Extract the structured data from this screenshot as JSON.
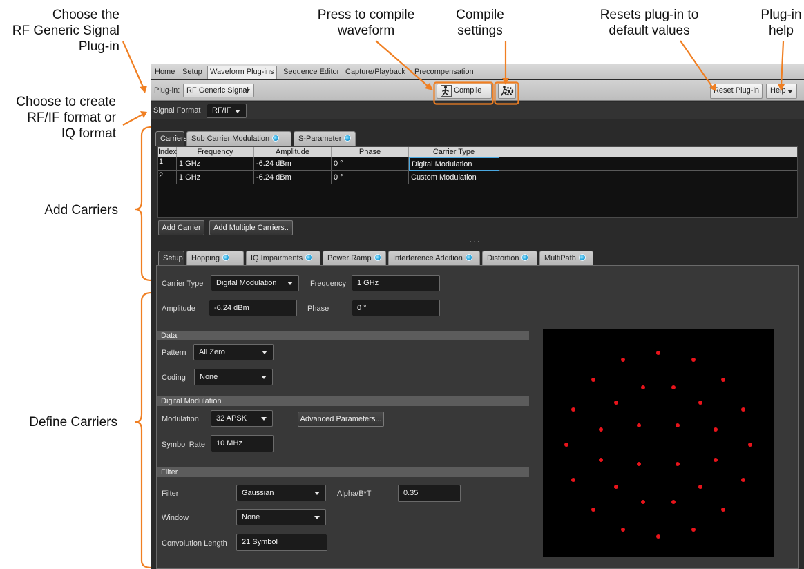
{
  "callouts": {
    "choose_plugin": [
      "Choose the",
      "RF Generic Signal",
      "Plug-in"
    ],
    "choose_format": [
      "Choose to create",
      "RF/IF format or",
      "IQ format"
    ],
    "add_carriers": "Add Carriers",
    "define_carriers": "Define Carriers",
    "compile_waveform": [
      "Press to compile",
      "waveform"
    ],
    "compile_settings": [
      "Compile",
      "settings"
    ],
    "reset": [
      "Resets plug-in to",
      "default values"
    ],
    "help": [
      "Plug-in",
      "help"
    ]
  },
  "colors": {
    "callout_accent": "#f07f22",
    "constellation_point": "#e8141b",
    "status_dot": "#1fa2dc"
  },
  "menu": {
    "tabs": [
      "Home",
      "Setup",
      "Waveform Plug-ins",
      "Sequence Editor",
      "Capture/Playback",
      "Precompensation"
    ],
    "active": "Waveform Plug-ins"
  },
  "toolbar": {
    "plugin_label": "Plug-in:",
    "plugin_value": "RF Generic Signal",
    "compile_label": "Compile",
    "compile_icon": "compile-runner-icon",
    "settings_icon": "gear-runner-icon",
    "reset_label": "Reset Plug-in",
    "help_label": "Help"
  },
  "signal_format": {
    "label": "Signal Format",
    "value": "RF/IF"
  },
  "top_tabs": [
    {
      "label": "Carriers",
      "active": true,
      "dot": false
    },
    {
      "label": "Sub Carrier Modulation",
      "active": false,
      "dot": true
    },
    {
      "label": "S-Parameter",
      "active": false,
      "dot": true
    }
  ],
  "carriers_table": {
    "headers": [
      "Index",
      "Frequency",
      "Amplitude",
      "Phase",
      "Carrier Type"
    ],
    "rows": [
      [
        "1",
        "1 GHz",
        "-6.24 dBm",
        "0 °",
        "Digital Modulation"
      ],
      [
        "2",
        "1 GHz",
        "-6.24 dBm",
        "0 °",
        "Custom Modulation"
      ]
    ]
  },
  "carrier_buttons": {
    "add": "Add Carrier",
    "add_multiple": "Add Multiple Carriers.."
  },
  "splitter": "· · ·",
  "sub_tabs": [
    {
      "label": "Setup",
      "active": true,
      "dot": false
    },
    {
      "label": "Hopping",
      "active": false,
      "dot": true
    },
    {
      "label": "IQ Impairments",
      "active": false,
      "dot": true
    },
    {
      "label": "Power Ramp",
      "active": false,
      "dot": true
    },
    {
      "label": "Interference Addition",
      "active": false,
      "dot": true
    },
    {
      "label": "Distortion",
      "active": false,
      "dot": true
    },
    {
      "label": "MultiPath",
      "active": false,
      "dot": true
    }
  ],
  "setup": {
    "carrier_type_label": "Carrier Type",
    "carrier_type_value": "Digital Modulation",
    "frequency_label": "Frequency",
    "frequency_value": "1 GHz",
    "amplitude_label": "Amplitude",
    "amplitude_value": "-6.24 dBm",
    "phase_label": "Phase",
    "phase_value": "0 °"
  },
  "data_section": {
    "title": "Data",
    "pattern_label": "Pattern",
    "pattern_value": "All Zero",
    "coding_label": "Coding",
    "coding_value": "None"
  },
  "modulation_section": {
    "title": "Digital Modulation",
    "modulation_label": "Modulation",
    "modulation_value": "32 APSK",
    "advanced_label": "Advanced Parameters...",
    "symbol_rate_label": "Symbol Rate",
    "symbol_rate_value": "10 MHz"
  },
  "filter_section": {
    "title": "Filter",
    "filter_label": "Filter",
    "filter_value": "Gaussian",
    "alpha_label": "Alpha/B*T",
    "alpha_value": "0.35",
    "window_label": "Window",
    "window_value": "None",
    "conv_label": "Convolution Length",
    "conv_value": "21 Symbol"
  },
  "constellation": {
    "modulation": "32 APSK",
    "rings": [
      {
        "radius": 1,
        "count": 4,
        "phase_deg": 45
      },
      {
        "radius": 2.2,
        "count": 12,
        "phase_deg": 15
      },
      {
        "radius": 3.4,
        "count": 16,
        "phase_deg": 0
      }
    ]
  }
}
